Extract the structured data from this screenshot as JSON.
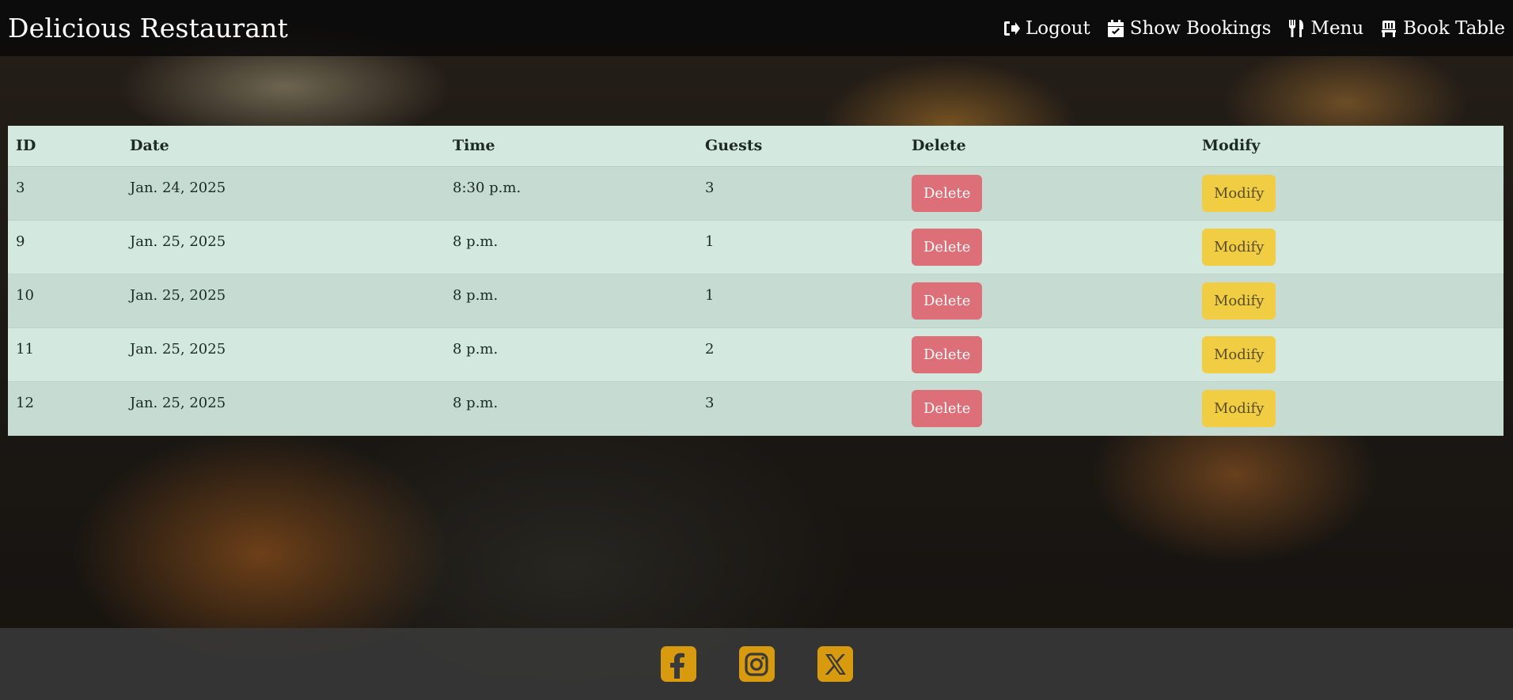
{
  "header": {
    "brand": "Delicious Restaurant",
    "nav": [
      {
        "label": "Logout",
        "icon": "logout-icon"
      },
      {
        "label": "Show Bookings",
        "icon": "calendar-check-icon"
      },
      {
        "label": "Menu",
        "icon": "utensils-icon"
      },
      {
        "label": "Book Table",
        "icon": "chair-icon"
      }
    ]
  },
  "table": {
    "columns": [
      "ID",
      "Date",
      "Time",
      "Guests",
      "Delete",
      "Modify"
    ],
    "rows": [
      {
        "id": "3",
        "date": "Jan. 24, 2025",
        "time": "8:30 p.m.",
        "guests": "3",
        "delete_label": "Delete",
        "modify_label": "Modify"
      },
      {
        "id": "9",
        "date": "Jan. 25, 2025",
        "time": "8 p.m.",
        "guests": "1",
        "delete_label": "Delete",
        "modify_label": "Modify"
      },
      {
        "id": "10",
        "date": "Jan. 25, 2025",
        "time": "8 p.m.",
        "guests": "1",
        "delete_label": "Delete",
        "modify_label": "Modify"
      },
      {
        "id": "11",
        "date": "Jan. 25, 2025",
        "time": "8 p.m.",
        "guests": "2",
        "delete_label": "Delete",
        "modify_label": "Modify"
      },
      {
        "id": "12",
        "date": "Jan. 25, 2025",
        "time": "8 p.m.",
        "guests": "3",
        "delete_label": "Delete",
        "modify_label": "Modify"
      }
    ]
  },
  "footer": {
    "social": [
      {
        "icon": "facebook-icon"
      },
      {
        "icon": "instagram-icon"
      },
      {
        "icon": "x-twitter-icon"
      }
    ]
  },
  "colors": {
    "delete_button": "#dc6f78",
    "modify_button": "#f1cd44",
    "social_icon_bg": "#d89b10",
    "table_row_light": "#d3e8de",
    "table_row_dark": "#c6dcd2"
  }
}
